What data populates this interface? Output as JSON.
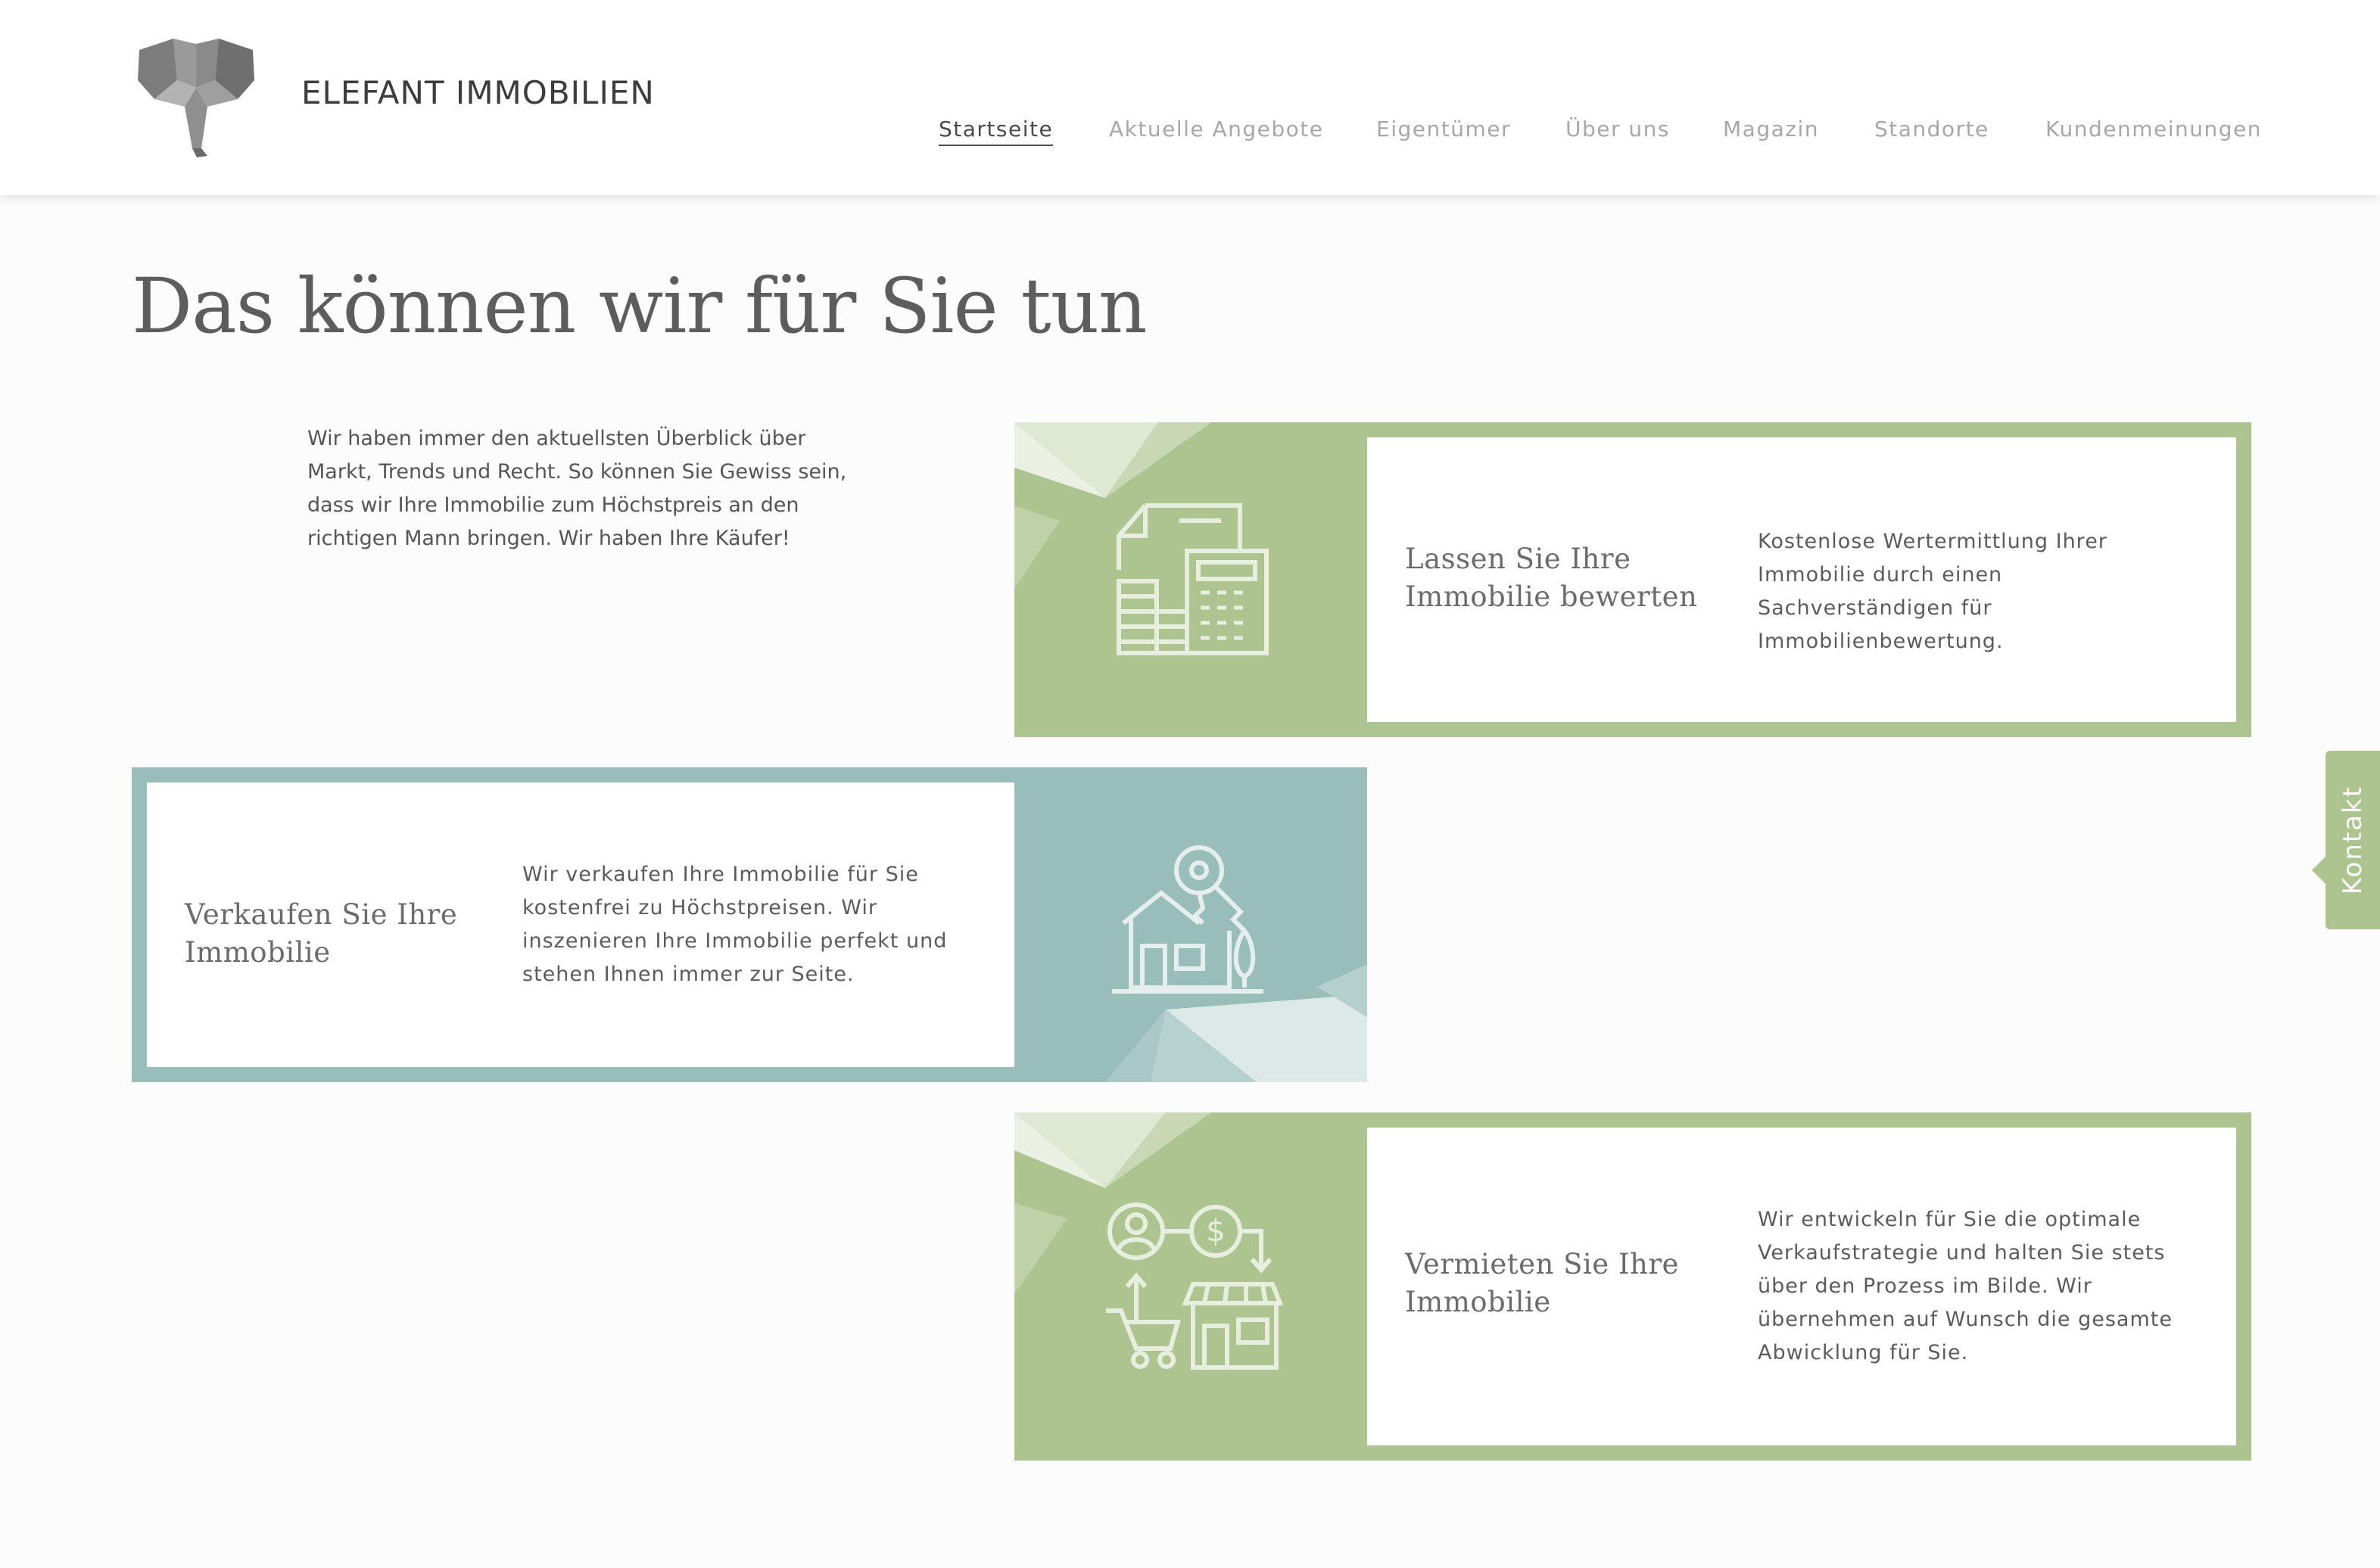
{
  "brand": {
    "name": "ELEFANT IMMOBILIEN",
    "logo_icon": "elephant-logo-icon"
  },
  "nav": {
    "items": [
      {
        "label": "Startseite",
        "active": true
      },
      {
        "label": "Aktuelle Angebote",
        "active": false
      },
      {
        "label": "Eigentümer",
        "active": false
      },
      {
        "label": "Über uns",
        "active": false
      },
      {
        "label": "Magazin",
        "active": false
      },
      {
        "label": "Standorte",
        "active": false
      },
      {
        "label": "Kundenmeinungen",
        "active": false
      }
    ]
  },
  "page": {
    "title": "Das können wir für Sie tun",
    "intro": "Wir haben immer den aktuellsten Überblick über Markt, Trends und Recht. So können Sie Gewiss sein, dass wir Ihre Immobilie zum Höchstpreis an den richtigen Mann bringen. Wir haben Ihre Käufer!"
  },
  "services": [
    {
      "title": "Lassen Sie Ihre Immobilie bewerten",
      "description": "Kostenlose Wertermittlung Ihrer Immobilie durch einen Sachverständigen für Immobilienbewertung.",
      "icon": "documents-calculator-icon",
      "color": "#aec490"
    },
    {
      "title": "Verkaufen Sie Ihre Immobilie",
      "description": "Wir verkaufen Ihre Immobilie für Sie kostenfrei zu Höchstpreisen. Wir inszenieren Ihre Immobilie perfekt und stehen Ihnen immer zur Seite.",
      "icon": "house-key-icon",
      "color": "#99bdb9"
    },
    {
      "title": "Vermieten Sie Ihre Immobilie",
      "description": "Wir entwickeln für Sie die optimale Verkaufstrategie und halten Sie stets über den Prozess im Bilde. Wir übernehmen auf Wunsch die gesamte Abwicklung für Sie.",
      "icon": "rental-exchange-icon",
      "color": "#aec490"
    }
  ],
  "contact_tab": {
    "label": "Kontakt"
  }
}
